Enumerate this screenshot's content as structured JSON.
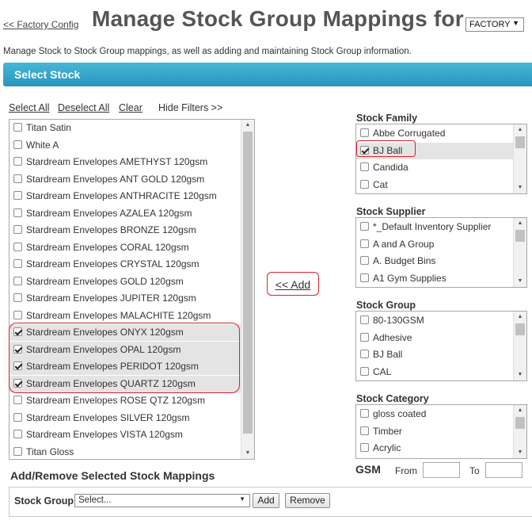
{
  "header": {
    "back_link": "<< Factory Config",
    "title": "Manage Stock Group Mappings for",
    "factory_select": "FACTORY",
    "description": "Manage Stock to Stock Group mappings, as well as adding and maintaining Stock Group information."
  },
  "section": {
    "title": "Select Stock"
  },
  "toolbar": {
    "select_all": "Select All",
    "deselect_all": "Deselect All",
    "clear": "Clear",
    "hide_filters": "Hide Filters >>"
  },
  "stock_list": {
    "items": [
      {
        "label": "Titan Satin",
        "checked": false
      },
      {
        "label": "White A",
        "checked": false
      },
      {
        "label": "Stardream Envelopes AMETHYST 120gsm",
        "checked": false
      },
      {
        "label": "Stardream Envelopes ANT GOLD 120gsm",
        "checked": false
      },
      {
        "label": "Stardream Envelopes ANTHRACITE 120gsm",
        "checked": false
      },
      {
        "label": "Stardream Envelopes AZALEA 120gsm",
        "checked": false
      },
      {
        "label": "Stardream Envelopes BRONZE 120gsm",
        "checked": false
      },
      {
        "label": "Stardream Envelopes CORAL 120gsm",
        "checked": false
      },
      {
        "label": "Stardream Envelopes CRYSTAL 120gsm",
        "checked": false
      },
      {
        "label": "Stardream Envelopes GOLD 120gsm",
        "checked": false
      },
      {
        "label": "Stardream Envelopes JUPITER 120gsm",
        "checked": false
      },
      {
        "label": "Stardream Envelopes MALACHITE 120gsm",
        "checked": false
      },
      {
        "label": "Stardream Envelopes ONYX 120gsm",
        "checked": true
      },
      {
        "label": "Stardream Envelopes OPAL 120gsm",
        "checked": true
      },
      {
        "label": "Stardream Envelopes PERIDOT 120gsm",
        "checked": true
      },
      {
        "label": "Stardream Envelopes QUARTZ 120gsm",
        "checked": true
      },
      {
        "label": "Stardream Envelopes ROSE QTZ 120gsm",
        "checked": false
      },
      {
        "label": "Stardream Envelopes SILVER 120gsm",
        "checked": false
      },
      {
        "label": "Stardream Envelopes VISTA 120gsm",
        "checked": false
      },
      {
        "label": "Titan Gloss",
        "checked": false
      }
    ]
  },
  "add_button": "<< Add",
  "filters": {
    "stock_family": {
      "label": "Stock Family",
      "items": [
        {
          "label": "Abbe Corrugated",
          "checked": false
        },
        {
          "label": "BJ Ball",
          "checked": true
        },
        {
          "label": "Candida",
          "checked": false
        },
        {
          "label": "Cat",
          "checked": false
        }
      ]
    },
    "stock_supplier": {
      "label": "Stock Supplier",
      "items": [
        {
          "label": "*_Default Inventory Supplier",
          "checked": false
        },
        {
          "label": "A and A Group",
          "checked": false
        },
        {
          "label": "A. Budget Bins",
          "checked": false
        },
        {
          "label": "A1 Gym Supplies",
          "checked": false
        }
      ]
    },
    "stock_group": {
      "label": "Stock Group",
      "items": [
        {
          "label": "80-130GSM",
          "checked": false
        },
        {
          "label": "Adhesive",
          "checked": false
        },
        {
          "label": "BJ Ball",
          "checked": false
        },
        {
          "label": "CAL",
          "checked": false
        }
      ]
    },
    "stock_category": {
      "label": "Stock Category",
      "items": [
        {
          "label": "gloss coated",
          "checked": false
        },
        {
          "label": "Timber",
          "checked": false
        },
        {
          "label": "Acrylic",
          "checked": false
        }
      ]
    },
    "gsm": {
      "label": "GSM",
      "from_label": "From",
      "to_label": "To",
      "from_value": "",
      "to_value": ""
    }
  },
  "mappings": {
    "title": "Add/Remove Selected Stock Mappings",
    "stock_group_label": "Stock Group",
    "stock_group_select": "Select...",
    "add_label": "Add",
    "remove_label": "Remove"
  },
  "colors": {
    "accent_bar": "#2e9fc6",
    "highlight_outline": "#d9232e",
    "selected_row": "#e4e4e4"
  }
}
